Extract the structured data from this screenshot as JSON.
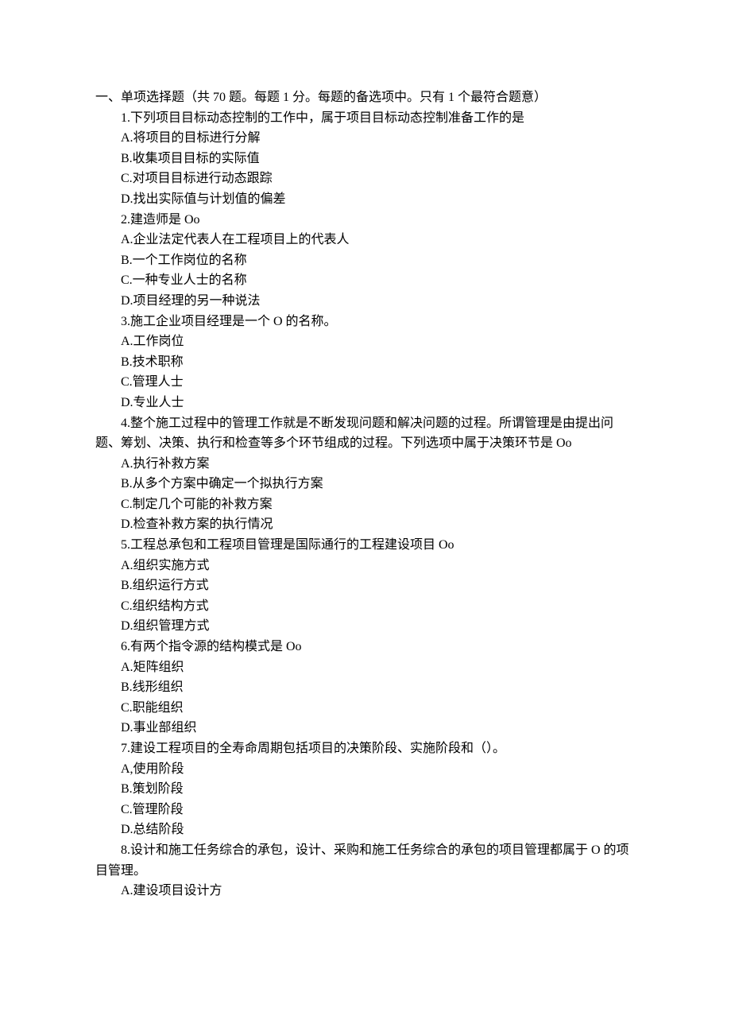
{
  "section_header": "一、单项选择题（共 70 题。每题 1 分。每题的备选项中。只有 1 个最符合题意）",
  "questions": [
    {
      "stem": "1.下列项目目标动态控制的工作中，属于项目目标动态控制准备工作的是",
      "options": [
        "A.将项目的目标进行分解",
        "B.收集项目目标的实际值",
        "C.对项目目标进行动态跟踪",
        "D.找出实际值与计划值的偏差"
      ]
    },
    {
      "stem": "2.建造师是 Oo",
      "options": [
        "A.企业法定代表人在工程项目上的代表人",
        "B.一个工作岗位的名称",
        "C.一种专业人士的名称",
        "D.项目经理的另一种说法"
      ]
    },
    {
      "stem": "3.施工企业项目经理是一个 O 的名称。",
      "options": [
        "A.工作岗位",
        "B.技术职称",
        "C.管理人士",
        "D.专业人士"
      ]
    },
    {
      "stem": "4.整个施工过程中的管理工作就是不断发现问题和解决问题的过程。所谓管理是由提出问题、筹划、决策、执行和检查等多个环节组成的过程。下列选项中属于决策环节是 Oo",
      "options": [
        "A.执行补救方案",
        "B.从多个方案中确定一个拟执行方案",
        "C.制定几个可能的补救方案",
        "D.检查补救方案的执行情况"
      ]
    },
    {
      "stem": "5.工程总承包和工程项目管理是国际通行的工程建设项目 Oo",
      "options": [
        "A.组织实施方式",
        "B.组织运行方式",
        "C.组织结构方式",
        "D.组织管理方式"
      ]
    },
    {
      "stem": "6.有两个指令源的结构模式是 Oo",
      "options": [
        "A.矩阵组织",
        "B.线形组织",
        "C.职能组织",
        "D.事业部组织"
      ]
    },
    {
      "stem": "7.建设工程项目的全寿命周期包括项目的决策阶段、实施阶段和（）。",
      "options": [
        "A,使用阶段",
        "B.策划阶段",
        "C.管理阶段",
        "D.总结阶段"
      ]
    },
    {
      "stem": "8.设计和施工任务综合的承包，设计、采购和施工任务综合的承包的项目管理都属于 O 的项目管理。",
      "options": [
        "A.建设项目设计方"
      ]
    }
  ]
}
